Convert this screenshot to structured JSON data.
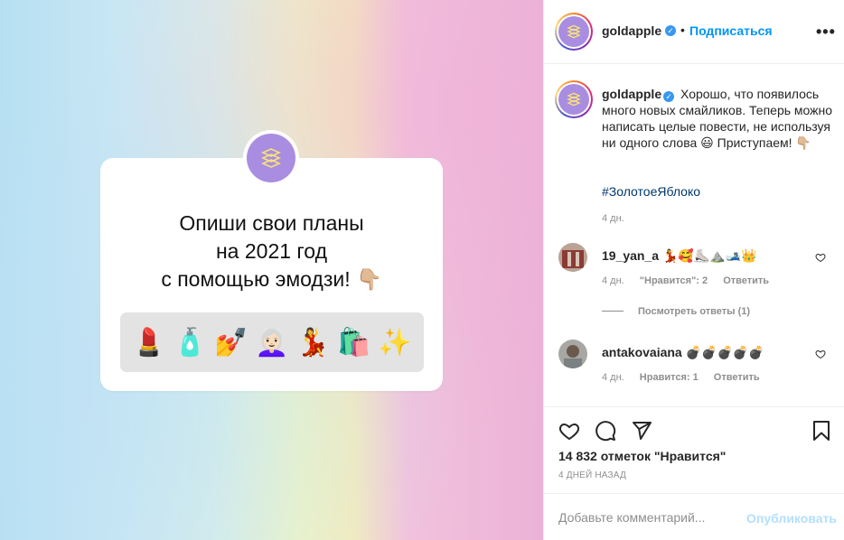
{
  "account": {
    "username": "goldapple",
    "follow_label": "Подписаться",
    "dot": "•",
    "more": "•••",
    "verified_icon": "verified-badge-icon"
  },
  "story": {
    "question_lines": [
      "Опиши свои планы",
      "на 2021 год",
      "с помощью эмодзи! 👇🏼"
    ],
    "emoji_answers": [
      "💄",
      "🧴",
      "💅",
      "👩🏻‍🦳",
      "💃",
      "🛍️",
      "✨"
    ]
  },
  "caption": {
    "username": "goldapple",
    "text": "Хорошо, что появилось много новых смайликов. Теперь можно написать целые повести, не используя ни одного слова 😃 Приступаем! 👇🏼",
    "hashtag": "#ЗолотоеЯблоко",
    "time": "4 дн."
  },
  "comments": [
    {
      "username": "19_yan_a",
      "text": "💃🥰⛸️⛰️🎿👑",
      "time": "4 дн.",
      "likes": "\"Нравится\": 2",
      "reply": "Ответить",
      "view_replies": "Посмотреть ответы (1)"
    },
    {
      "username": "antakovaiana",
      "text": "💣💣💣💣💣",
      "time": "4 дн.",
      "likes": "Нравится: 1",
      "reply": "Ответить"
    }
  ],
  "actions": {
    "like_icon": "heart-icon",
    "comment_icon": "comment-icon",
    "share_icon": "share-icon",
    "save_icon": "bookmark-icon"
  },
  "likes_count": "14 832 отметок \"Нравится\"",
  "post_time": "4 ДНЕЙ НАЗАД",
  "add_comment": {
    "placeholder": "Добавьте комментарий...",
    "publish_label": "Опубликовать"
  },
  "colors": {
    "accent_blue": "#0095f6",
    "publish_disabled": "#b2dffc",
    "logo_purple": "#a98de0",
    "hashtag": "#00376b"
  }
}
